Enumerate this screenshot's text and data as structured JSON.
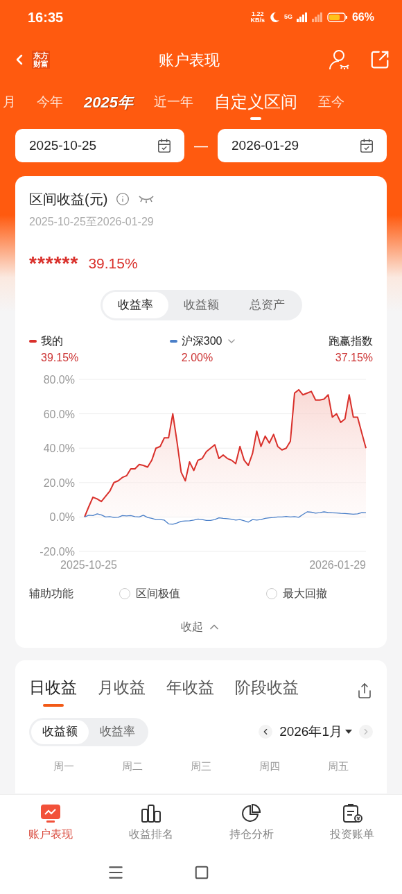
{
  "status_bar": {
    "time": "16:35",
    "net_speed": [
      "1.22",
      "KB/s"
    ],
    "network": "5G",
    "battery": "66%"
  },
  "nav": {
    "logo_lines": [
      "东方",
      "财富"
    ],
    "title": "账户表现"
  },
  "periods": [
    {
      "label": "月",
      "selected": false,
      "kind": "plain"
    },
    {
      "label": "今年",
      "selected": false,
      "kind": "plain"
    },
    {
      "label": "2025年",
      "selected": false,
      "kind": "special"
    },
    {
      "label": "近一年",
      "selected": false,
      "kind": "plain"
    },
    {
      "label": "自定义区间",
      "selected": true,
      "kind": "plain"
    },
    {
      "label": "至今",
      "selected": false,
      "kind": "plain"
    }
  ],
  "date_range": {
    "start": "2025-10-25",
    "separator": "—",
    "end": "2026-01-29"
  },
  "summary": {
    "title": "区间收益(元)",
    "range": "2025-10-25至2026-01-29",
    "amount": "******",
    "rate": "39.15%",
    "modes": [
      {
        "label": "收益率",
        "selected": true
      },
      {
        "label": "收益额",
        "selected": false
      },
      {
        "label": "总资产",
        "selected": false
      }
    ],
    "legend": [
      {
        "value": "39.15%",
        "dropdown": false
      },
      {
        "value": "2.00%",
        "dropdown": true
      },
      {
        "name": "跑赢指数",
        "value": "37.15%",
        "dropdown": false
      }
    ],
    "axis_dates": [
      "2025-10-25",
      "2026-01-29"
    ],
    "chart_data": {
      "type": "area",
      "grid": true,
      "ylim": [
        -20,
        80
      ],
      "yticks": [
        {
          "value": -20,
          "label": "-20.0%"
        },
        {
          "value": 0,
          "label": "0.0%"
        },
        {
          "value": 20,
          "label": "20.0%"
        },
        {
          "value": 40,
          "label": "40.0%"
        },
        {
          "value": 60,
          "label": "60.0%"
        },
        {
          "value": 80,
          "label": "80.0%"
        }
      ],
      "series": [
        {
          "name": "我的",
          "color": "#d9302b",
          "type": "area",
          "values": [
            0,
            6,
            11.5,
            10.5,
            9,
            12,
            15,
            20,
            21,
            23,
            24,
            28,
            28,
            30.5,
            30,
            29,
            33,
            40,
            41,
            46,
            46,
            60,
            44,
            26,
            21,
            32,
            27,
            33,
            34,
            38,
            40,
            42,
            34,
            36,
            34,
            33,
            31,
            41,
            33,
            30,
            37,
            50,
            41,
            47,
            43,
            48,
            41,
            39,
            40,
            44,
            72,
            74,
            71,
            72,
            73,
            68,
            68,
            68.5,
            71,
            58,
            60,
            55,
            57,
            71,
            58,
            58,
            49,
            40
          ]
        },
        {
          "name": "沪深300",
          "color": "#4a7fc8",
          "type": "line",
          "values": [
            0,
            1,
            0.8,
            1.8,
            1.2,
            0,
            0.2,
            -0.3,
            -0.2,
            0.8,
            0.6,
            0.8,
            0.2,
            0,
            1,
            -0.3,
            -0.8,
            -1.5,
            -1.5,
            -1.8,
            -4,
            -4.2,
            -3.5,
            -2.5,
            -2.3,
            -2.2,
            -1.8,
            -1.2,
            -1.5,
            -2,
            -2,
            -1.5,
            -0.5,
            -0.8,
            -1,
            -1.3,
            -1.8,
            -1.5,
            -2.2,
            -3,
            -1.5,
            -1.8,
            -1.5,
            -0.8,
            -0.5,
            -0.3,
            0,
            0,
            0.3,
            0,
            0.2,
            -0.2,
            1.5,
            3,
            2.8,
            2.2,
            2.5,
            3,
            2.6,
            2.4,
            2.3,
            2.1,
            2,
            1.8,
            1.6,
            1.8,
            2.5,
            2.4
          ]
        }
      ]
    },
    "aux_label": "辅助功能",
    "aux_options": [
      {
        "label": "区间极值",
        "checked": false
      },
      {
        "label": "最大回撤",
        "checked": false
      }
    ],
    "collapse": "收起"
  },
  "returns": {
    "tabs": [
      {
        "label": "日收益",
        "selected": true
      },
      {
        "label": "月收益",
        "selected": false
      },
      {
        "label": "年收益",
        "selected": false
      },
      {
        "label": "阶段收益",
        "selected": false
      }
    ],
    "modes": [
      {
        "label": "收益额",
        "selected": true
      },
      {
        "label": "收益率",
        "selected": false
      }
    ],
    "month": "2026年1月",
    "weekdays": [
      "周一",
      "周二",
      "周三",
      "周四",
      "周五"
    ]
  },
  "bottom_nav": [
    {
      "label": "账户表现",
      "selected": true,
      "kind": "monitor"
    },
    {
      "label": "收益排名",
      "selected": false,
      "kind": "bars"
    },
    {
      "label": "持仓分析",
      "selected": false,
      "kind": "pie"
    },
    {
      "label": "投资账单",
      "selected": false,
      "kind": "bill"
    }
  ]
}
